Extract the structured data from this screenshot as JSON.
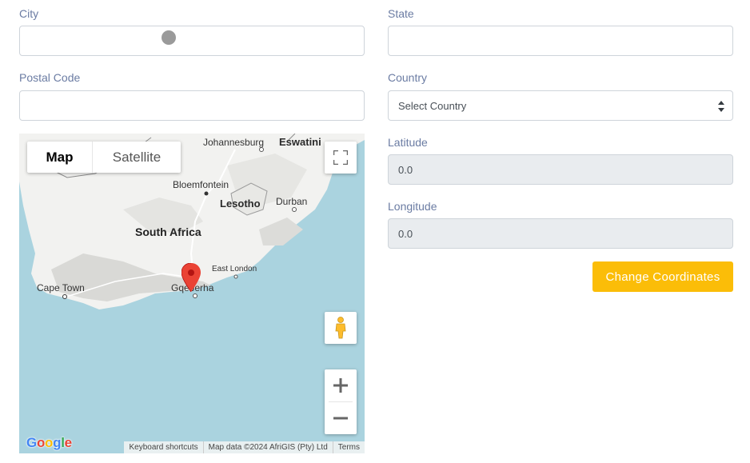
{
  "form": {
    "city": {
      "label": "City",
      "value": ""
    },
    "state": {
      "label": "State",
      "value": ""
    },
    "postal_code": {
      "label": "Postal Code",
      "value": ""
    },
    "country": {
      "label": "Country",
      "value": "Select Country"
    },
    "latitude": {
      "label": "Latitude",
      "value": "0.0"
    },
    "longitude": {
      "label": "Longitude",
      "value": "0.0"
    },
    "change_button": "Change Coordinates"
  },
  "map": {
    "map_type": {
      "map": "Map",
      "satellite": "Satellite"
    },
    "labels": {
      "johannesburg": "Johannesburg",
      "eswatini": "Eswatini",
      "bloemfontein": "Bloemfontein",
      "lesotho": "Lesotho",
      "durban": "Durban",
      "south_africa": "South Africa",
      "east_london": "East London",
      "cape_town": "Cape Town",
      "gqeberha": "Gqeberha"
    },
    "logo_letters": [
      "G",
      "o",
      "o",
      "g",
      "l",
      "e"
    ],
    "attribution": {
      "shortcuts": "Keyboard shortcuts",
      "data": "Map data ©2024 AfriGIS (Pty) Ltd",
      "terms": "Terms"
    },
    "colors": {
      "water": "#aad3df",
      "land": "#f2f2f0",
      "pin": "#ea4335",
      "button_accent": "#fbbd08"
    },
    "icons": [
      "fullscreen-icon",
      "pegman-icon",
      "zoom-in-icon",
      "zoom-out-icon",
      "map-pin-icon"
    ]
  }
}
